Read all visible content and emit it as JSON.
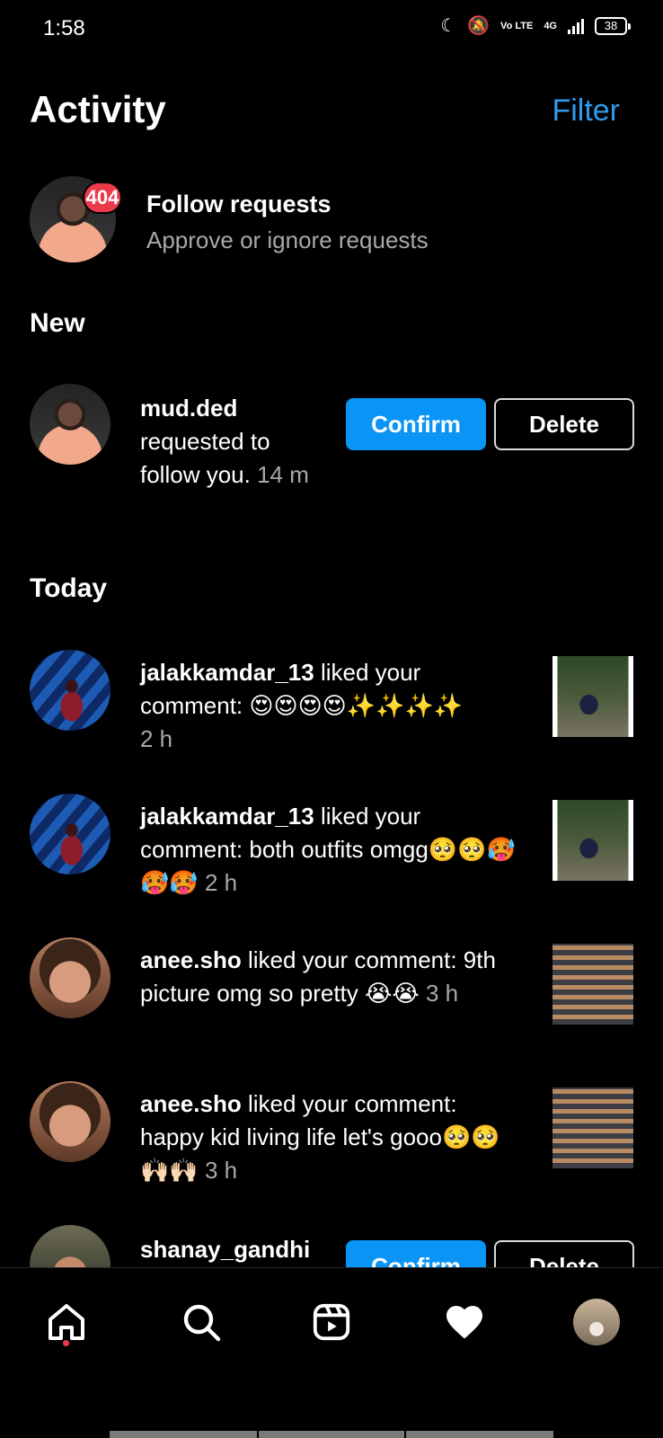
{
  "status_bar": {
    "time": "1:58",
    "network_label": "4G",
    "volte_label": "Vo LTE",
    "battery": "38"
  },
  "header": {
    "title": "Activity",
    "filter_label": "Filter"
  },
  "follow_requests": {
    "title": "Follow requests",
    "subtitle": "Approve or ignore requests",
    "badge_count": "404"
  },
  "sections": {
    "new": "New",
    "today": "Today"
  },
  "new_items": [
    {
      "username": "mud.ded",
      "text": "requested to follow you.",
      "time": "14 m",
      "confirm_label": "Confirm",
      "delete_label": "Delete"
    }
  ],
  "today_items": [
    {
      "username": "jalakkamdar_13",
      "text": " liked your comment: 😍😍😍😍✨✨✨✨",
      "time": "2 h"
    },
    {
      "username": "jalakkamdar_13",
      "text": " liked your comment: both outfits omgg🥺🥺🥵🥵🥵",
      "time": "2 h"
    },
    {
      "username": "anee.sho",
      "text": " liked your comment: 9th picture omg so pretty 😭😭",
      "time": "3 h"
    },
    {
      "username": "anee.sho",
      "text": " liked your comment: happy kid living life let's gooo🥺🥺🙌🏻🙌🏻",
      "time": "3 h"
    },
    {
      "username": "shanay_gandhi",
      "confirm_label": "Confirm",
      "delete_label": "Delete"
    }
  ],
  "colors": {
    "accent": "#0a95f6",
    "filter": "#2f9bf0",
    "badge": "#ec3a4d",
    "muted_text": "#a8a8a8"
  },
  "bottom_nav": {
    "icons": [
      "home-icon",
      "search-icon",
      "reels-icon",
      "heart-icon",
      "profile-avatar"
    ]
  }
}
